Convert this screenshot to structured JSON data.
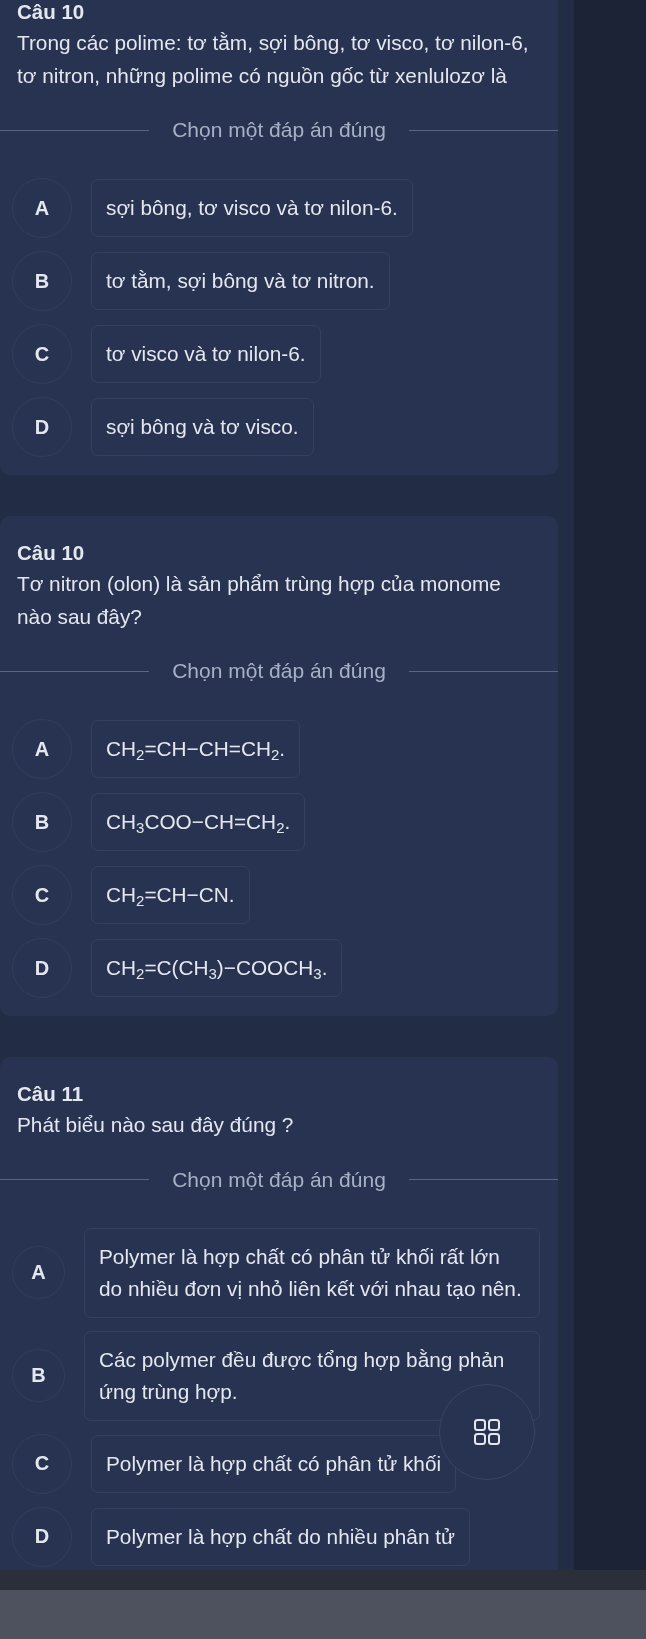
{
  "questions": [
    {
      "title": "Câu 10",
      "text": "Trong các polime: tơ tằm, sợi bông, tơ visco, tơ nilon-6, tơ nitron, những polime có nguồn gốc từ xenlulozơ là",
      "instruction": "Chọn một đáp án đúng",
      "options": [
        {
          "letter": "A",
          "text": "sợi bông, tơ visco và tơ nilon-6."
        },
        {
          "letter": "B",
          "text": "tơ tằm, sợi bông và tơ nitron."
        },
        {
          "letter": "C",
          "text": "tơ visco và tơ nilon-6."
        },
        {
          "letter": "D",
          "text": "sợi bông và tơ visco."
        }
      ]
    },
    {
      "title": "Câu 10",
      "text": "Tơ nitron (olon) là sản phẩm trùng hợp của monome nào sau đây?",
      "instruction": "Chọn một đáp án đúng",
      "options": [
        {
          "letter": "A",
          "text": "CH$_{2}$=CH−CH=CH$_{2}$."
        },
        {
          "letter": "B",
          "text": "CH$_{3}$COO−CH=CH$_{2}$."
        },
        {
          "letter": "C",
          "text": "CH$_{2}$=CH−CN."
        },
        {
          "letter": "D",
          "text": "CH$_{2}$=C(CH$_{3}$)−COOCH$_{3}$."
        }
      ]
    },
    {
      "title": "Câu 11",
      "text": "Phát biểu nào sau đây đúng ?",
      "instruction": "Chọn một đáp án đúng",
      "options": [
        {
          "letter": "A",
          "text": "Polymer là hợp chất có phân tử khối rất lớn do nhiều đơn vị nhỏ liên kết với nhau tạo nên."
        },
        {
          "letter": "B",
          "text": "Các polymer đều được tổng hợp bằng phản ứng trùng hợp."
        },
        {
          "letter": "C",
          "text": "Polymer là hợp chất có phân tử khối"
        },
        {
          "letter": "D",
          "text": "Polymer là hợp chất do nhiều phân tử"
        }
      ]
    }
  ]
}
